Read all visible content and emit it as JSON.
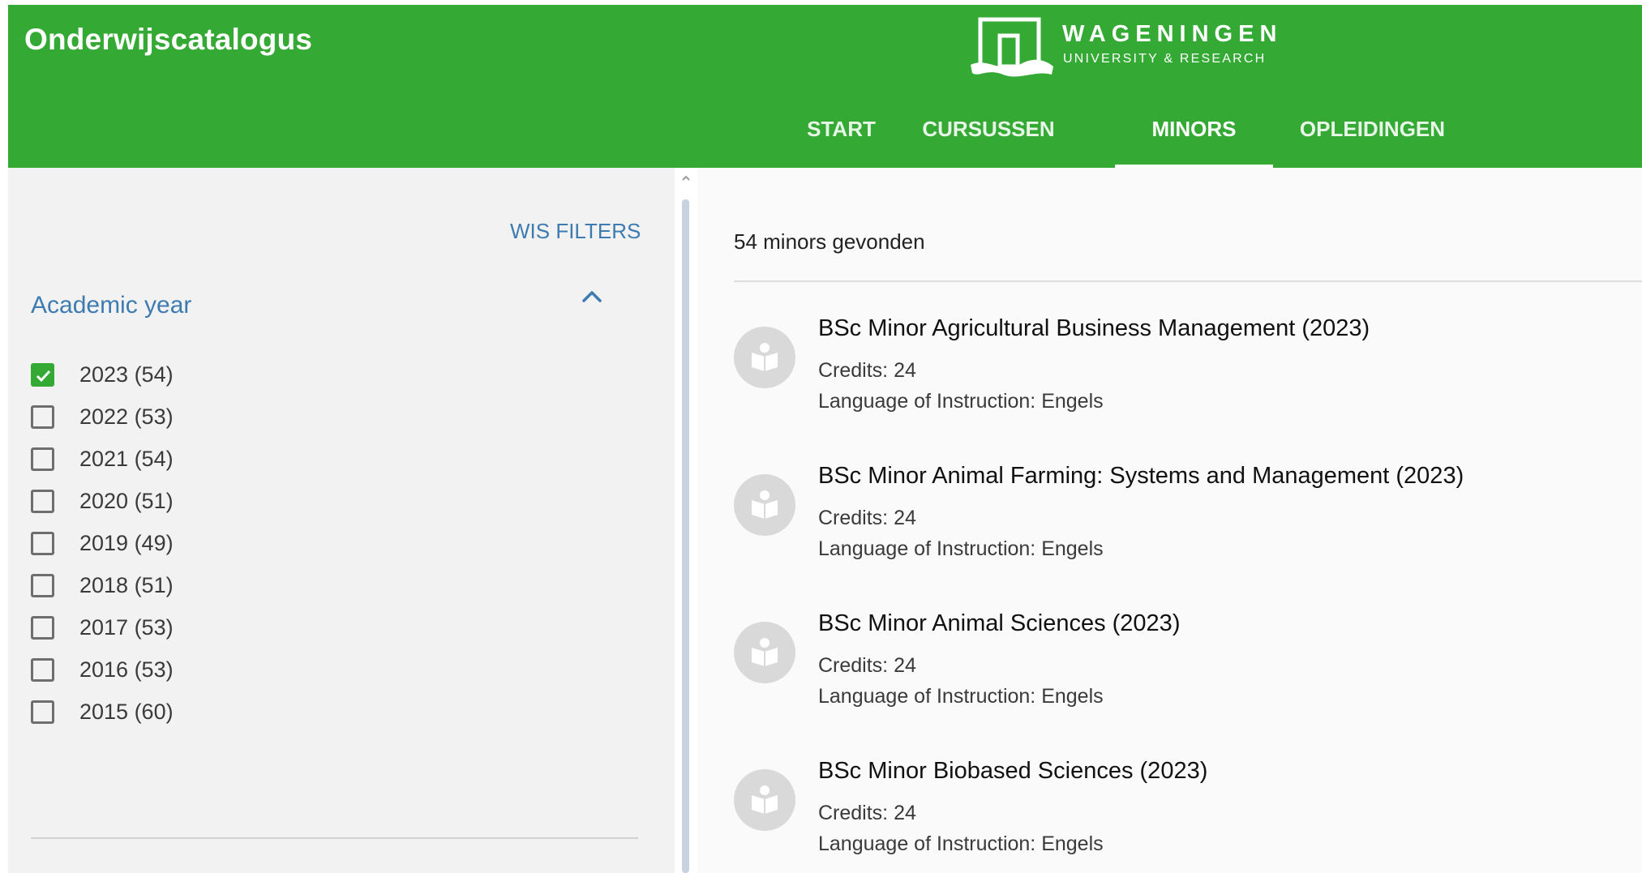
{
  "header": {
    "app_title": "Onderwijscatalogus",
    "logo": {
      "name": "WAGENINGEN",
      "subtitle": "UNIVERSITY & RESEARCH"
    },
    "nav": [
      {
        "label": "START",
        "active": false
      },
      {
        "label": "CURSUSSEN",
        "active": false
      },
      {
        "label": "MINORS",
        "active": true
      },
      {
        "label": "OPLEIDINGEN",
        "active": false
      }
    ]
  },
  "sidebar": {
    "clear_filters_label": "WIS FILTERS",
    "facet": {
      "title": "Academic year",
      "toggle_icon": "chevron-up-icon",
      "items": [
        {
          "label": "2023 (54)",
          "checked": true
        },
        {
          "label": "2022 (53)",
          "checked": false
        },
        {
          "label": "2021 (54)",
          "checked": false
        },
        {
          "label": "2020 (51)",
          "checked": false
        },
        {
          "label": "2019 (49)",
          "checked": false
        },
        {
          "label": "2018 (51)",
          "checked": false
        },
        {
          "label": "2017 (53)",
          "checked": false
        },
        {
          "label": "2016 (53)",
          "checked": false
        },
        {
          "label": "2015 (60)",
          "checked": false
        }
      ]
    }
  },
  "main": {
    "results_count": "54 minors gevonden",
    "results": [
      {
        "title": "BSc Minor Agricultural Business Management (2023)",
        "credits": "Credits: 24",
        "language": "Language of Instruction: Engels",
        "icon": "book-reader-icon"
      },
      {
        "title": "BSc Minor Animal Farming: Systems and Management (2023)",
        "credits": "Credits: 24",
        "language": "Language of Instruction: Engels",
        "icon": "book-reader-icon"
      },
      {
        "title": "BSc Minor Animal Sciences (2023)",
        "credits": "Credits: 24",
        "language": "Language of Instruction: Engels",
        "icon": "book-reader-icon"
      },
      {
        "title": "BSc Minor Biobased Sciences (2023)",
        "credits": "Credits: 24",
        "language": "Language of Instruction: Engels",
        "icon": "book-reader-icon"
      }
    ]
  },
  "colors": {
    "brand_green": "#34a934",
    "link_blue": "#3d7bb0",
    "icon_grey": "#d9d9d9"
  }
}
